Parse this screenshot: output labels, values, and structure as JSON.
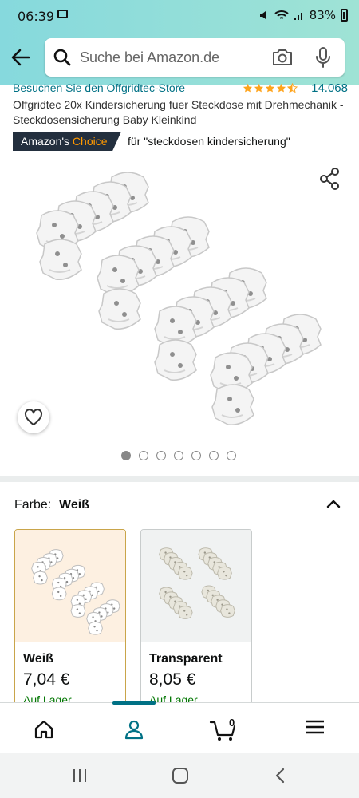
{
  "status_bar": {
    "time": "06:39",
    "battery": "83%"
  },
  "search": {
    "placeholder": "Suche bei Amazon.de"
  },
  "product": {
    "store_link": "Besuchen Sie den Offgridtec-Store",
    "rating": 4.5,
    "rating_count": "14.068",
    "title": "Offgridtec 20x Kindersicherung fuer Steckdose mit Drehmechanik - Steckdosensicherung Baby Kleinkind",
    "badge_prefix": "Amazon's",
    "badge_accent": "Choice",
    "badge_for": "für \"steckdosen kindersicherung\"",
    "image_count": 7,
    "active_image": 1
  },
  "variation": {
    "label": "Farbe:",
    "selected": "Weiß",
    "options": [
      {
        "name": "Weiß",
        "price": "7,04 €",
        "stock": "Auf Lager"
      },
      {
        "name": "Transparent",
        "price": "8,05 €",
        "stock": "Auf Lager"
      }
    ]
  },
  "bottom_nav": {
    "cart_count": "0"
  },
  "colors": {
    "link": "#007185",
    "badge_bg": "#232f3e",
    "badge_accent": "#ff9900",
    "in_stock": "#007600",
    "header_gradient_start": "#86d9dd",
    "header_gradient_end": "#9fe3d5",
    "rating_star": "#ffa41c"
  },
  "icons": [
    "back-arrow-icon",
    "search-icon",
    "camera-icon",
    "mic-icon",
    "share-icon",
    "heart-icon",
    "chevron-up-icon",
    "home-icon",
    "account-icon",
    "cart-icon",
    "menu-icon",
    "recent-apps-icon",
    "home-button-icon",
    "back-nav-icon"
  ]
}
